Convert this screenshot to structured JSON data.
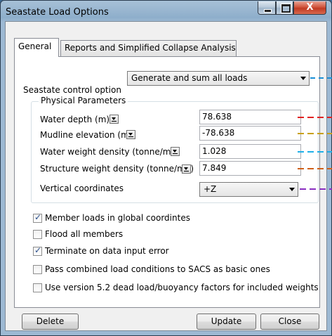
{
  "window": {
    "title": "Seastate Load Options",
    "close_label": "X"
  },
  "tabs": [
    {
      "label": "General",
      "active": true
    },
    {
      "label": "Reports and Simplified Collapse Analysis",
      "active": false
    }
  ],
  "seastate": {
    "label": "Seastate control option",
    "value": "Generate and sum all loads"
  },
  "physical": {
    "title": "Physical Parameters",
    "rows": [
      {
        "label": "Water depth  (m)",
        "value": "78.638"
      },
      {
        "label": "Mudline elevation  (m)",
        "value": "-78.638"
      },
      {
        "label": "Water weight density  (tonne/m3)",
        "value": "1.028"
      },
      {
        "label": "Structure weight density  (tonne/m3)",
        "value": "7.849"
      }
    ],
    "vertical": {
      "label": "Vertical coordinates",
      "value": "+Z"
    }
  },
  "options": [
    {
      "label": "Member loads in global coordintes",
      "checked": true
    },
    {
      "label": "Flood all members",
      "checked": false
    },
    {
      "label": "Terminate on data input error",
      "checked": true
    },
    {
      "label": "Pass combined load conditions to SACS as basic ones",
      "checked": false
    },
    {
      "label": "Use version 5.2 dead load/buoyancy factors for included weights",
      "checked": false
    }
  ],
  "buttons": {
    "delete": "Delete",
    "update": "Update",
    "close": "Close"
  },
  "colors": {
    "seastate_line": "#1a8fd6",
    "water_depth_line": "#e02020",
    "mudline_line": "#c8a018",
    "water_density_line": "#20b0e8",
    "structure_density_line": "#d06018",
    "vertical_line": "#8a2ec0"
  }
}
